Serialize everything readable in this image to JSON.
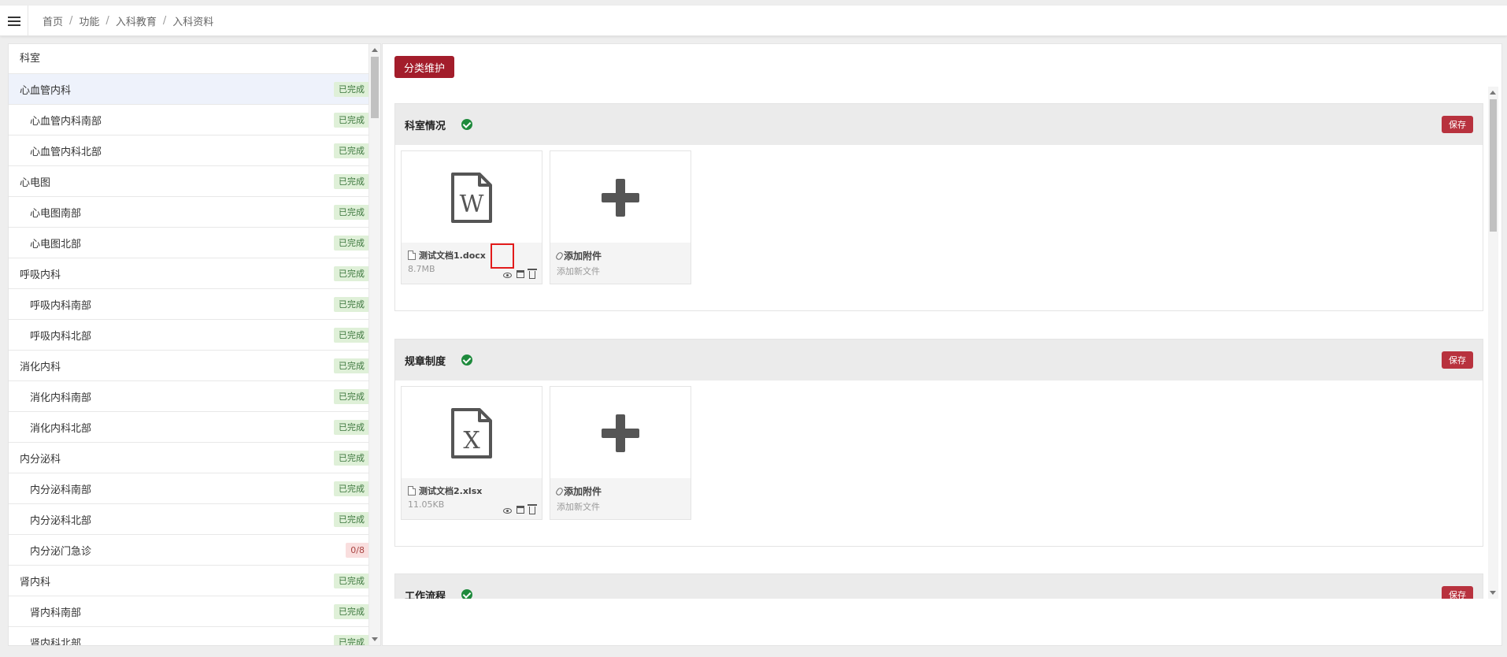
{
  "breadcrumb": [
    "首页",
    "功能",
    "入科教育",
    "入科资料"
  ],
  "colors": {
    "primary": "#a31d2b",
    "save": "#b8323e",
    "done_bg": "#dff0d8",
    "pending_bg": "#f9dede",
    "check": "#1e8a3c"
  },
  "left_panel": {
    "header": "科室",
    "departments": [
      {
        "name": "心血管内科",
        "level": 1,
        "status": "已完成",
        "state": "done",
        "active": true
      },
      {
        "name": "心血管内科南部",
        "level": 2,
        "status": "已完成",
        "state": "done"
      },
      {
        "name": "心血管内科北部",
        "level": 2,
        "status": "已完成",
        "state": "done"
      },
      {
        "name": "心电图",
        "level": 1,
        "status": "已完成",
        "state": "done"
      },
      {
        "name": "心电图南部",
        "level": 2,
        "status": "已完成",
        "state": "done"
      },
      {
        "name": "心电图北部",
        "level": 2,
        "status": "已完成",
        "state": "done"
      },
      {
        "name": "呼吸内科",
        "level": 1,
        "status": "已完成",
        "state": "done"
      },
      {
        "name": "呼吸内科南部",
        "level": 2,
        "status": "已完成",
        "state": "done"
      },
      {
        "name": "呼吸内科北部",
        "level": 2,
        "status": "已完成",
        "state": "done"
      },
      {
        "name": "消化内科",
        "level": 1,
        "status": "已完成",
        "state": "done"
      },
      {
        "name": "消化内科南部",
        "level": 2,
        "status": "已完成",
        "state": "done"
      },
      {
        "name": "消化内科北部",
        "level": 2,
        "status": "已完成",
        "state": "done"
      },
      {
        "name": "内分泌科",
        "level": 1,
        "status": "已完成",
        "state": "done"
      },
      {
        "name": "内分泌科南部",
        "level": 2,
        "status": "已完成",
        "state": "done"
      },
      {
        "name": "内分泌科北部",
        "level": 2,
        "status": "已完成",
        "state": "done"
      },
      {
        "name": "内分泌门急诊",
        "level": 2,
        "status": "0/8",
        "state": "pending"
      },
      {
        "name": "肾内科",
        "level": 1,
        "status": "已完成",
        "state": "done"
      },
      {
        "name": "肾内科南部",
        "level": 2,
        "status": "已完成",
        "state": "done"
      },
      {
        "name": "肾内科北部",
        "level": 2,
        "status": "已完成",
        "state": "done"
      }
    ]
  },
  "right_panel": {
    "category_button": "分类维护",
    "sections": [
      {
        "title": "科室情况",
        "save_label": "保存",
        "file": {
          "name": "测试文档1.docx",
          "size": "8.7MB",
          "icon": "word-file-icon",
          "letter": "W"
        },
        "add": {
          "title": "添加附件",
          "subtitle": "添加新文件"
        }
      },
      {
        "title": "规章制度",
        "save_label": "保存",
        "file": {
          "name": "测试文档2.xlsx",
          "size": "11.05KB",
          "icon": "excel-file-icon",
          "letter": "X"
        },
        "add": {
          "title": "添加附件",
          "subtitle": "添加新文件"
        }
      },
      {
        "title": "工作流程",
        "save_label": "保存"
      }
    ]
  }
}
